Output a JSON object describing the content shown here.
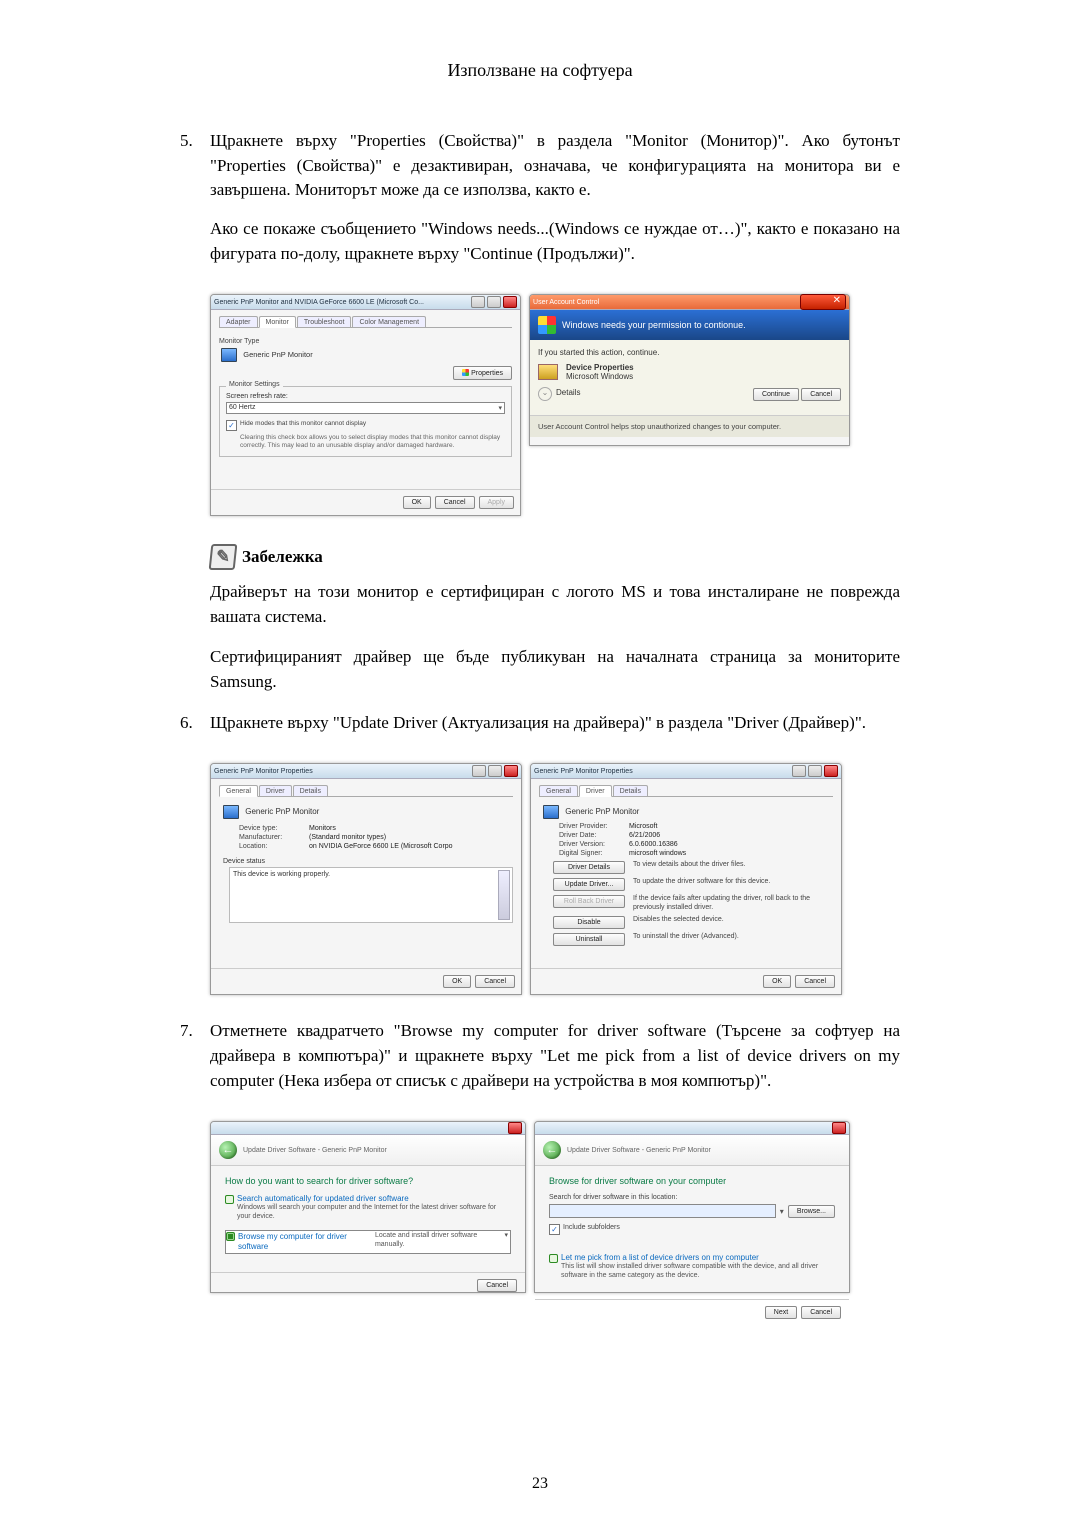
{
  "page": {
    "title": "Използване на софтуера",
    "number": "23"
  },
  "step5": {
    "num": "5.",
    "p1": "Щракнете върху \"Properties (Свойства)\" в раздела \"Monitor (Монитор)\". Ако бутонът \"Properties (Свойства)\" е дезактивиран, означава, че конфигурацията на монитора ви е завършена. Мониторът може да се използва, както е.",
    "p2": "Ако се покаже съобщението \"Windows needs...(Windows се нуждае от…)\", както е показано на фигурата по-долу, щракнете върху \"Continue (Продължи)\"."
  },
  "figA": {
    "title": "Generic PnP Monitor and NVIDIA GeForce 6600 LE (Microsoft Co...",
    "tabs": {
      "adapter": "Adapter",
      "monitor": "Monitor",
      "troubleshoot": "Troubleshoot",
      "color": "Color Management"
    },
    "monitor_type_label": "Monitor Type",
    "monitor_name": "Generic PnP Monitor",
    "properties_btn": "Properties",
    "settings_label": "Monitor Settings",
    "refresh_label": "Screen refresh rate:",
    "refresh_value": "60 Hertz",
    "hide_modes": "Hide modes that this monitor cannot display",
    "hide_modes_desc": "Clearing this check box allows you to select display modes that this monitor cannot display correctly. This may lead to an unusable display and/or damaged hardware.",
    "ok": "OK",
    "cancel": "Cancel",
    "apply": "Apply"
  },
  "figB": {
    "title": "User Account Control",
    "headline": "Windows needs your permission to contionue.",
    "if_started": "If you started this action, continue.",
    "app_name": "Device Properties",
    "publisher": "Microsoft Windows",
    "details": "Details",
    "continue": "Continue",
    "cancel": "Cancel",
    "footer": "User Account Control helps stop unauthorized changes to your computer."
  },
  "note": {
    "heading": "Забележка",
    "p1": "Драйверът на този монитор е сертифициран с логото MS и това инсталиране не поврежда вашата система.",
    "p2": "Сертифицираният драйвер ще бъде публикуван на началната страница за мониторите Samsung."
  },
  "step6": {
    "num": "6.",
    "p1": "Щракнете върху \"Update Driver (Актуализация на драйвера)\" в раздела \"Driver (Драйвер)\"."
  },
  "figC": {
    "title": "Generic PnP Monitor Properties",
    "tabs": {
      "general": "General",
      "driver": "Driver",
      "details": "Details"
    },
    "name": "Generic PnP Monitor",
    "k1": "Device type:",
    "v1": "Monitors",
    "k2": "Manufacturer:",
    "v2": "(Standard monitor types)",
    "k3": "Location:",
    "v3": "on NVIDIA GeForce 6600 LE (Microsoft Corpo",
    "status_label": "Device status",
    "status_text": "This device is working properly.",
    "ok": "OK",
    "cancel": "Cancel"
  },
  "figD": {
    "title": "Generic PnP Monitor Properties",
    "tabs": {
      "general": "General",
      "driver": "Driver",
      "details": "Details"
    },
    "name": "Generic PnP Monitor",
    "k1": "Driver Provider:",
    "v1": "Microsoft",
    "k2": "Driver Date:",
    "v2": "6/21/2006",
    "k3": "Driver Version:",
    "v3": "6.0.6000.16386",
    "k4": "Digital Signer:",
    "v4": "microsoft windows",
    "b1": "Driver Details",
    "d1": "To view details about the driver files.",
    "b2": "Update Driver...",
    "d2": "To update the driver software for this device.",
    "b3": "Roll Back Driver",
    "d3": "If the device fails after updating the driver, roll back to the previously installed driver.",
    "b4": "Disable",
    "d4": "Disables the selected device.",
    "b5": "Uninstall",
    "d5": "To uninstall the driver (Advanced).",
    "ok": "OK",
    "cancel": "Cancel"
  },
  "step7": {
    "num": "7.",
    "p1": "Отметнете квадратчето \"Browse my computer for driver software (Търсене за софтуер на драйвера в компютъра)\" и щракнете върху \"Let me pick from a list of device drivers on my computer (Нека избера от списък с драйвери на устройства в моя компютър)\"."
  },
  "figE": {
    "crumb": "Update Driver Software - Generic PnP Monitor",
    "headline": "How do you want to search for driver software?",
    "opt1_t": "Search automatically for updated driver software",
    "opt1_d": "Windows will search your computer and the Internet for the latest driver software for your device.",
    "opt2_t": "Browse my computer for driver software",
    "opt2_d": "Locate and install driver software manually.",
    "cancel": "Cancel"
  },
  "figF": {
    "crumb": "Update Driver Software - Generic PnP Monitor",
    "headline": "Browse for driver software on your computer",
    "search_label": "Search for driver software in this location:",
    "browse": "Browse...",
    "include": "Include subfolders",
    "opt_t": "Let me pick from a list of device drivers on my computer",
    "opt_d": "This list will show installed driver software compatible with the device, and all driver software in the same category as the device.",
    "next": "Next",
    "cancel": "Cancel"
  }
}
